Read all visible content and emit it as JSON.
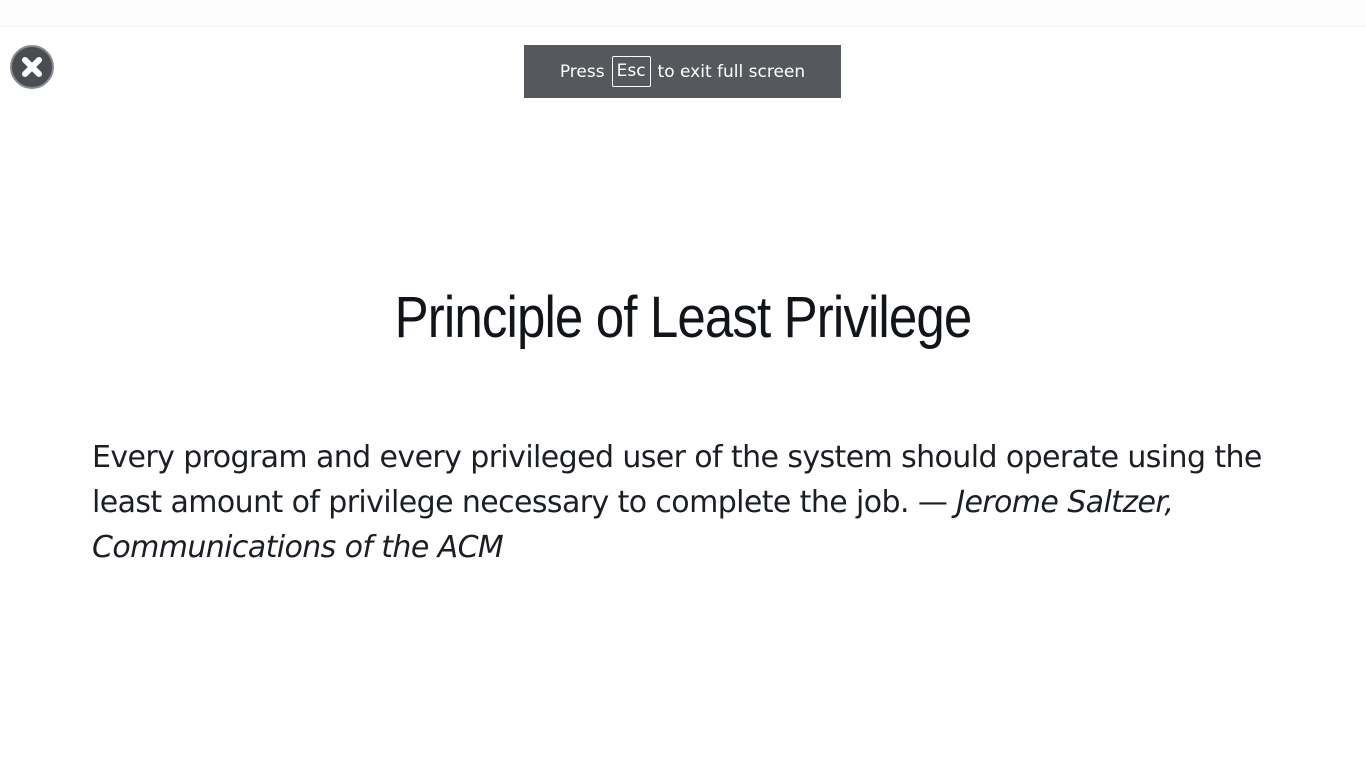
{
  "fullscreen_notice": {
    "prefix": "Press",
    "key": "Esc",
    "suffix": "to exit full screen"
  },
  "close_icon": "close-icon",
  "slide": {
    "title": "Principle of Least Privilege",
    "quote": "Every program and every privileged user of the system should operate using the least amount of privilege necessary to complete the job. — ",
    "attribution": "Jerome Saltzer, Communications of the ACM"
  },
  "colors": {
    "toast_background": "#55585c",
    "close_button": "#4a4e52",
    "text": "#111418"
  }
}
